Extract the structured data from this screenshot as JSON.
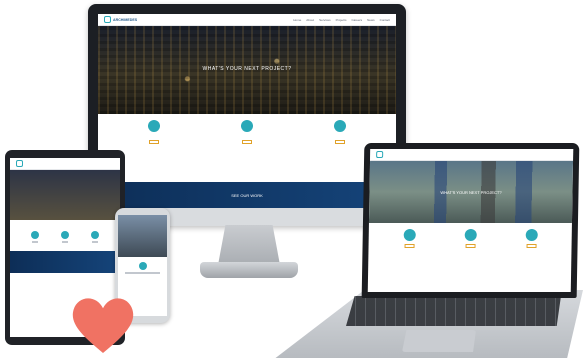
{
  "site": {
    "logo_text": "ARCHIMEDES",
    "nav": [
      "Home",
      "About",
      "Services",
      "Projects",
      "Careers",
      "News",
      "Contact"
    ],
    "hero_title": "WHAT'S YOUR NEXT PROJECT?",
    "hero_subtitle": "",
    "features": [
      {
        "title": "",
        "text": "",
        "button": ""
      },
      {
        "title": "",
        "text": "",
        "button": ""
      },
      {
        "title": "",
        "text": "",
        "button": ""
      }
    ],
    "cta_text": "SEE OUR WORK"
  },
  "laptop": {
    "hero_title": "WHAT'S YOUR NEXT PROJECT?"
  },
  "tablet": {
    "hero_title": ""
  },
  "phone": {
    "hero_title": ""
  },
  "colors": {
    "accent_teal": "#2aa9b8",
    "brand_navy": "#15447a",
    "button_gold": "#e0a22a",
    "heart": "#f07263"
  },
  "icons": [
    "heart-icon"
  ]
}
